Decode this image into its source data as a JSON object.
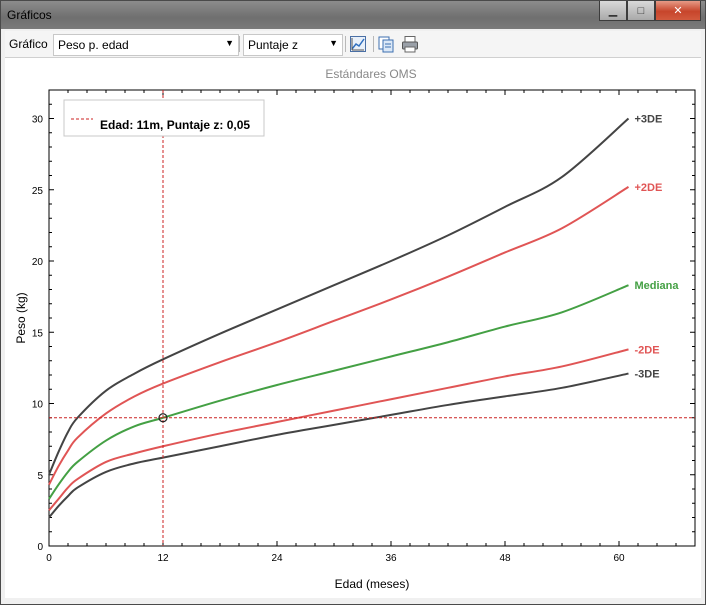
{
  "window": {
    "title": "Gráficos",
    "controls": {
      "minimize": "▁",
      "maximize": "□",
      "close": "✕"
    }
  },
  "toolbar": {
    "chart_label": "Gráfico",
    "chart_select": "Peso p. edad",
    "scale_select": "Puntaje z",
    "icons": [
      "chart-settings-icon",
      "copy-icon",
      "print-icon"
    ]
  },
  "colors": {
    "sd3": "#444444",
    "sd2": "#e05555",
    "median": "#44a044",
    "crosshair": "#cc2222"
  },
  "chart_data": {
    "type": "line",
    "title": "Estándares OMS",
    "xlabel": "Edad (meses)",
    "ylabel": "Peso (kg)",
    "xlim": [
      0,
      68
    ],
    "ylim": [
      0,
      32
    ],
    "xticks": [
      0,
      12,
      24,
      36,
      48,
      60
    ],
    "yticks": [
      0,
      5,
      10,
      15,
      20,
      25,
      30
    ],
    "x": [
      0,
      1,
      2,
      3,
      6,
      9,
      12,
      18,
      24,
      30,
      36,
      42,
      48,
      54,
      61
    ],
    "series": [
      {
        "name": "+3DE",
        "color": "#444444",
        "values": [
          5.0,
          6.6,
          8.0,
          9.0,
          10.9,
          12.1,
          13.1,
          14.9,
          16.6,
          18.3,
          20.0,
          21.8,
          23.8,
          25.9,
          30.0
        ]
      },
      {
        "name": "+2DE",
        "color": "#e05555",
        "values": [
          4.3,
          5.6,
          6.7,
          7.6,
          9.3,
          10.5,
          11.4,
          12.9,
          14.3,
          15.8,
          17.3,
          18.9,
          20.6,
          22.3,
          25.2
        ]
      },
      {
        "name": "Mediana",
        "color": "#44a044",
        "values": [
          3.3,
          4.3,
          5.2,
          5.9,
          7.4,
          8.4,
          9.0,
          10.2,
          11.3,
          12.3,
          13.3,
          14.3,
          15.4,
          16.4,
          18.3
        ]
      },
      {
        "name": "-2DE",
        "color": "#e05555",
        "values": [
          2.5,
          3.3,
          4.1,
          4.7,
          5.9,
          6.5,
          7.0,
          7.9,
          8.7,
          9.5,
          10.3,
          11.1,
          11.9,
          12.6,
          13.8
        ]
      },
      {
        "name": "-3DE",
        "color": "#444444",
        "values": [
          2.0,
          2.8,
          3.5,
          4.1,
          5.2,
          5.8,
          6.2,
          7.0,
          7.8,
          8.5,
          9.2,
          9.9,
          10.5,
          11.1,
          12.1
        ]
      }
    ],
    "marker": {
      "x": 12,
      "y": 9.0
    },
    "legend": {
      "text": "Edad: 11m, Puntaje z: 0,05",
      "position": "top-left"
    },
    "grid": false
  }
}
